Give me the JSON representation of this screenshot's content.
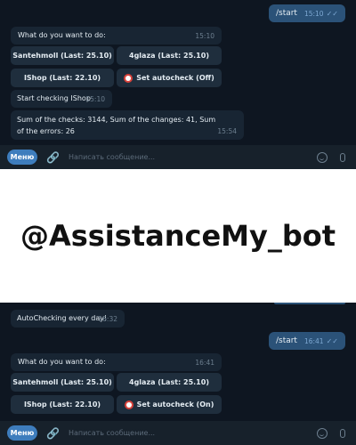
{
  "banner": {
    "text": "@AssistanceMy_bot"
  },
  "top": {
    "outgoing": {
      "text": "/start",
      "time": "15:10"
    },
    "prompt": {
      "text": "What do you want to do:",
      "time": "15:10"
    },
    "keyboard": [
      {
        "label": "Santehmoll (Last: 25.10)"
      },
      {
        "label": "4glaza (Last: 25.10)"
      },
      {
        "label": "IShop (Last: 22.10)"
      },
      {
        "label": "Set autocheck (Off)",
        "icon": "alarm-clock-icon"
      }
    ],
    "checking": {
      "text": "Start checking IShop",
      "time": "15:10"
    },
    "summary": {
      "text": "Sum of the checks: 3144, Sum of the changes: 41, Sum of the errors: 26",
      "time": "15:54"
    },
    "input": {
      "menu_label": "Меню",
      "placeholder": "Написать сообщение..."
    }
  },
  "bottom": {
    "autocheck": {
      "text": "AutoChecking every day!",
      "time": "16:32"
    },
    "outgoing": {
      "text": "/start",
      "time": "16:41"
    },
    "prompt": {
      "text": "What do you want to do:",
      "time": "16:41"
    },
    "keyboard": [
      {
        "label": "Santehmoll (Last: 25.10)"
      },
      {
        "label": "4glaza (Last: 25.10)"
      },
      {
        "label": "IShop (Last: 22.10)"
      },
      {
        "label": "Set autocheck (On)",
        "icon": "alarm-clock-icon"
      }
    ],
    "input": {
      "menu_label": "Меню",
      "placeholder": "Написать сообщение..."
    }
  },
  "colors": {
    "chat_bg": "#0e1621",
    "incoming_bubble": "#182533",
    "outgoing_bubble": "#2b5278",
    "keyboard_button": "#1f2e3d",
    "menu_button": "#3e7dbd"
  }
}
